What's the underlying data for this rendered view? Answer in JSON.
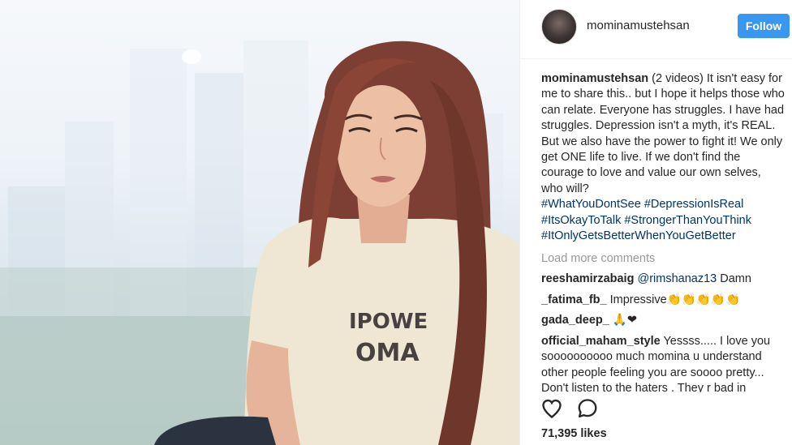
{
  "post": {
    "username": "mominamustehsan",
    "follow_label": "Follow",
    "caption": {
      "username": "mominamustehsan",
      "text": " (2 videos) It isn't easy for me to share this.. but I hope it helps those who can relate. Everyone has struggles. I have had struggles. Depression isn't a myth, it's REAL. But we also have the power to fight it! We only get ONE life to live. If we don't find the courage to love and value our own selves, who will?",
      "hashtags": [
        "#WhatYouDontSee #DepressionIsReal",
        "#ItsOkayToTalk #StrongerThanYouThink",
        "#ItOnlyGetsBetterWhenYouGetBetter"
      ]
    },
    "load_more": "Load more comments",
    "comments": [
      {
        "username": "reeshamirzabaig",
        "mention": "@rimshanaz13",
        "text": " Damn"
      },
      {
        "username": "_fatima_fb_",
        "mention": "",
        "text": " Impressive👏👏👏👏👏"
      },
      {
        "username": "gada_deep_",
        "mention": "",
        "text": " 🙏❤"
      },
      {
        "username": "official_maham_style",
        "mention": "",
        "text": " Yessss..... I love you soooooooooo much momina u understand other people feeling you are soooo pretty... Don't listen to the haters . They r bad in"
      }
    ],
    "likes": "71,395 likes",
    "icons": {
      "like": "heart-icon",
      "comment": "comment-icon"
    },
    "colors": {
      "follow": "#3897f0",
      "hashtag": "#003569",
      "muted": "#999999"
    }
  }
}
